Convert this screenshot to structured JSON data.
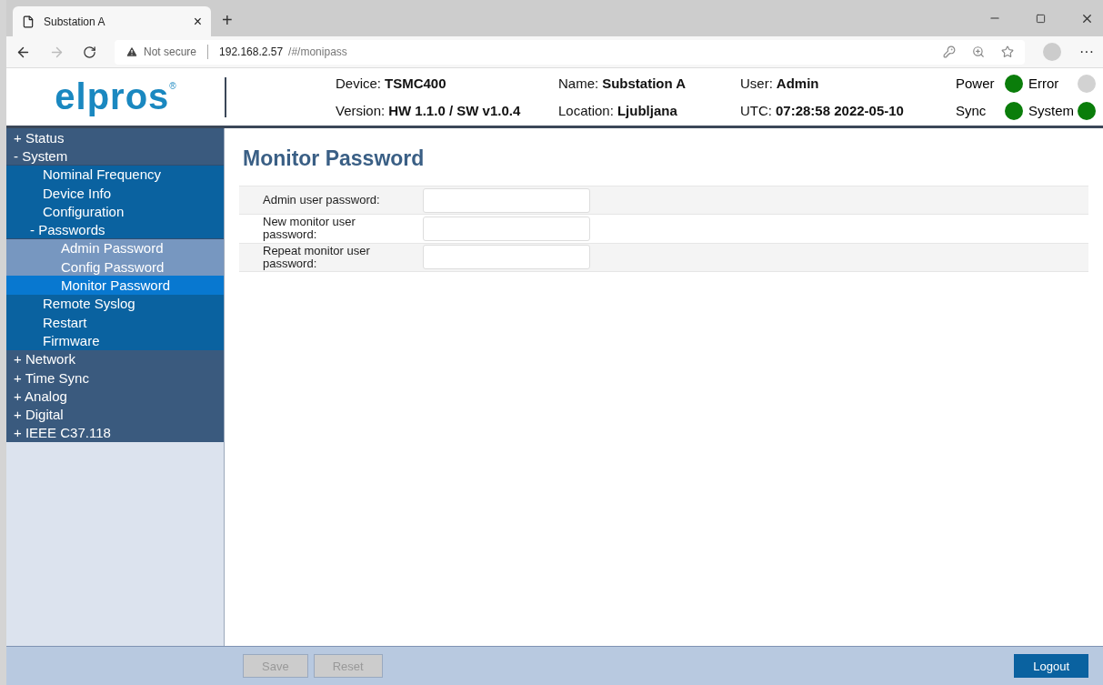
{
  "browser": {
    "tab_title": "Substation A",
    "tab_close": "×",
    "new_tab": "+",
    "security": "Not secure",
    "url_host": "192.168.2.57",
    "url_path": "/#/monipass",
    "more": "···"
  },
  "header": {
    "logo": "elpros",
    "logo_mark": "®",
    "fields": [
      {
        "label": "Device:",
        "value": "TSMC400"
      },
      {
        "label": "Version:",
        "value": "HW 1.1.0 / SW v1.0.4"
      },
      {
        "label": "Name:",
        "value": "Substation A"
      },
      {
        "label": "Location:",
        "value": "Ljubljana"
      },
      {
        "label": "User:",
        "value": "Admin"
      },
      {
        "label": "UTC:",
        "value": "07:28:58 2022-05-10"
      }
    ],
    "indicators": [
      {
        "label": "Power",
        "on": true
      },
      {
        "label": "Error",
        "on": false
      },
      {
        "label": "Sync",
        "on": true
      },
      {
        "label": "System",
        "on": true
      }
    ]
  },
  "sidebar": {
    "items": [
      {
        "marker": "+",
        "label": "Status",
        "selected": false
      },
      {
        "marker": "-",
        "label": "System",
        "expanded": true,
        "selected": false,
        "children": [
          {
            "label": "Nominal Frequency",
            "selected": false
          },
          {
            "label": "Device Info",
            "selected": false
          },
          {
            "label": "Configuration",
            "selected": false
          },
          {
            "marker": "-",
            "label": "Passwords",
            "expanded": true,
            "selected": false,
            "children": [
              {
                "label": "Admin Password",
                "selected": false
              },
              {
                "label": "Config Password",
                "selected": false
              },
              {
                "label": "Monitor Password",
                "selected": true
              }
            ]
          },
          {
            "label": "Remote Syslog",
            "selected": false
          },
          {
            "label": "Restart",
            "selected": false
          },
          {
            "label": "Firmware",
            "selected": false
          }
        ]
      },
      {
        "marker": "+",
        "label": "Network",
        "selected": false
      },
      {
        "marker": "+",
        "label": "Time Sync",
        "selected": false
      },
      {
        "marker": "+",
        "label": "Analog",
        "selected": false
      },
      {
        "marker": "+",
        "label": "Digital",
        "selected": false
      },
      {
        "marker": "+",
        "label": "IEEE C37.118",
        "selected": false
      }
    ]
  },
  "page": {
    "title": "Monitor Password",
    "fields": [
      {
        "label": "Admin user password:"
      },
      {
        "label": "New monitor user password:"
      },
      {
        "label": "Repeat monitor user password:"
      }
    ]
  },
  "footer": {
    "left_buttons": [
      {
        "label": "Save",
        "disabled": true
      },
      {
        "label": "Reset",
        "disabled": true
      }
    ],
    "right_buttons": [
      {
        "label": "Logout",
        "disabled": false
      }
    ]
  }
}
